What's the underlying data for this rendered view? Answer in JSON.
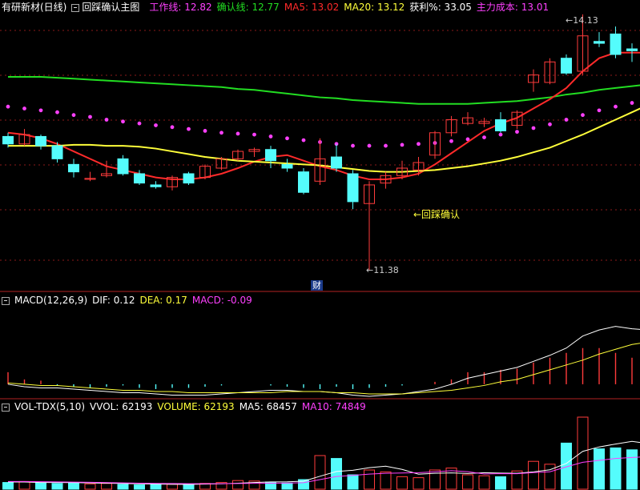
{
  "window": {
    "stock_name": "有研新材(日线)",
    "indicator_name": "回踩确认主图"
  },
  "main_header": {
    "work_line_label": "工作线: 12.82",
    "confirm_line_label": "确认线: 12.77",
    "ma5_label": "MA5: 13.02",
    "ma20_label": "MA20: 13.12",
    "profit_label": "获利%: 33.05",
    "main_cost_label": "主力成本: 13.01"
  },
  "annotations": {
    "high_label": "14.13",
    "low_label": "11.38",
    "confirm_label": "←回踩确认",
    "cai_badge": "财"
  },
  "macd_header": {
    "name": "MACD(12,26,9)",
    "dif_label": "DIF: 0.12",
    "dea_label": "DEA: 0.17",
    "macd_label": "MACD: -0.09"
  },
  "vol_header": {
    "name": "VOL-TDX(5,10)",
    "vvol_label": "VVOL: 62193",
    "volume_label": "VOLUME: 62193",
    "ma5_label": "MA5: 68457",
    "ma10_label": "MA10: 74849"
  },
  "colors": {
    "background": "#000000",
    "grid": "#8b1a1a",
    "pane_border": "#b22222",
    "rise": "#ff3b3b",
    "fall": "#54fcfc",
    "work_line": "#ff40ff",
    "confirm_line": "#22dd22",
    "ma5": "#ff2a2a",
    "ma20": "#ffff3a",
    "white_line": "#ffffff",
    "yellow_line": "#ffff3a",
    "magenta_line": "#ff40ff",
    "high_low_label": "#cccccc",
    "confirm_annotation": "#ffff3a",
    "badge_bg": "#1a3a8a"
  },
  "chart_data": [
    {
      "type": "candlestick",
      "title": "回踩确认主图",
      "y_range": [
        11.3,
        14.2
      ],
      "high_mark": 14.13,
      "low_mark": 11.38,
      "candles": [
        {
          "o": 12.82,
          "h": 12.86,
          "l": 12.7,
          "c": 12.74
        },
        {
          "o": 12.74,
          "h": 12.9,
          "l": 12.72,
          "c": 12.84
        },
        {
          "o": 12.82,
          "h": 12.84,
          "l": 12.68,
          "c": 12.72
        },
        {
          "o": 12.72,
          "h": 12.76,
          "l": 12.54,
          "c": 12.58
        },
        {
          "o": 12.52,
          "h": 12.58,
          "l": 12.38,
          "c": 12.44
        },
        {
          "o": 12.36,
          "h": 12.44,
          "l": 12.34,
          "c": 12.37
        },
        {
          "o": 12.4,
          "h": 12.56,
          "l": 12.38,
          "c": 12.42
        },
        {
          "o": 12.58,
          "h": 12.62,
          "l": 12.4,
          "c": 12.42
        },
        {
          "o": 12.42,
          "h": 12.46,
          "l": 12.3,
          "c": 12.32
        },
        {
          "o": 12.3,
          "h": 12.34,
          "l": 12.26,
          "c": 12.28
        },
        {
          "o": 12.28,
          "h": 12.4,
          "l": 12.24,
          "c": 12.38
        },
        {
          "o": 12.42,
          "h": 12.44,
          "l": 12.3,
          "c": 12.32
        },
        {
          "o": 12.38,
          "h": 12.52,
          "l": 12.36,
          "c": 12.5
        },
        {
          "o": 12.48,
          "h": 12.6,
          "l": 12.46,
          "c": 12.58
        },
        {
          "o": 12.58,
          "h": 12.68,
          "l": 12.56,
          "c": 12.66
        },
        {
          "o": 12.66,
          "h": 12.7,
          "l": 12.6,
          "c": 12.68
        },
        {
          "o": 12.68,
          "h": 12.72,
          "l": 12.48,
          "c": 12.56
        },
        {
          "o": 12.52,
          "h": 12.58,
          "l": 12.44,
          "c": 12.48
        },
        {
          "o": 12.44,
          "h": 12.48,
          "l": 12.2,
          "c": 12.22
        },
        {
          "o": 12.34,
          "h": 12.8,
          "l": 12.3,
          "c": 12.58
        },
        {
          "o": 12.6,
          "h": 12.74,
          "l": 12.44,
          "c": 12.48
        },
        {
          "o": 12.42,
          "h": 12.46,
          "l": 12.04,
          "c": 12.12
        },
        {
          "o": 12.1,
          "h": 12.34,
          "l": 11.38,
          "c": 12.3
        },
        {
          "o": 12.32,
          "h": 12.44,
          "l": 12.26,
          "c": 12.4
        },
        {
          "o": 12.4,
          "h": 12.56,
          "l": 12.36,
          "c": 12.48
        },
        {
          "o": 12.46,
          "h": 12.6,
          "l": 12.4,
          "c": 12.54
        },
        {
          "o": 12.62,
          "h": 12.88,
          "l": 12.58,
          "c": 12.86
        },
        {
          "o": 12.86,
          "h": 13.04,
          "l": 12.82,
          "c": 13.0
        },
        {
          "o": 12.96,
          "h": 13.08,
          "l": 12.94,
          "c": 13.02
        },
        {
          "o": 12.96,
          "h": 13.02,
          "l": 12.92,
          "c": 12.98
        },
        {
          "o": 13.0,
          "h": 13.08,
          "l": 12.86,
          "c": 12.88
        },
        {
          "o": 12.94,
          "h": 13.1,
          "l": 12.9,
          "c": 13.08
        },
        {
          "o": 13.4,
          "h": 13.54,
          "l": 13.3,
          "c": 13.48
        },
        {
          "o": 13.4,
          "h": 13.66,
          "l": 13.38,
          "c": 13.62
        },
        {
          "o": 13.66,
          "h": 13.7,
          "l": 13.48,
          "c": 13.5
        },
        {
          "o": 13.52,
          "h": 14.13,
          "l": 13.48,
          "c": 13.9
        },
        {
          "o": 13.84,
          "h": 13.94,
          "l": 13.78,
          "c": 13.82
        },
        {
          "o": 13.92,
          "h": 14.0,
          "l": 13.66,
          "c": 13.7
        },
        {
          "o": 13.76,
          "h": 13.82,
          "l": 13.62,
          "c": 13.74
        },
        {
          "o": 13.76,
          "h": 13.8,
          "l": 13.6,
          "c": 13.64
        }
      ],
      "series": [
        {
          "name": "确认线",
          "values": [
            13.46,
            13.46,
            13.46,
            13.45,
            13.44,
            13.43,
            13.42,
            13.41,
            13.4,
            13.39,
            13.38,
            13.37,
            13.36,
            13.35,
            13.33,
            13.32,
            13.3,
            13.28,
            13.26,
            13.24,
            13.23,
            13.21,
            13.2,
            13.19,
            13.18,
            13.17,
            13.17,
            13.17,
            13.17,
            13.18,
            13.19,
            13.2,
            13.22,
            13.24,
            13.27,
            13.29,
            13.32,
            13.34,
            13.36,
            13.38
          ]
        },
        {
          "name": "工作线",
          "values": [
            13.14,
            13.12,
            13.1,
            13.08,
            13.05,
            13.03,
            13.0,
            12.98,
            12.96,
            12.94,
            12.92,
            12.9,
            12.88,
            12.86,
            12.85,
            12.84,
            12.82,
            12.8,
            12.78,
            12.76,
            12.74,
            12.72,
            12.72,
            12.72,
            12.73,
            12.74,
            12.75,
            12.77,
            12.79,
            12.81,
            12.84,
            12.87,
            12.91,
            12.95,
            13.0,
            13.05,
            13.1,
            13.14,
            13.18,
            13.21
          ]
        },
        {
          "name": "MA5",
          "values": [
            12.86,
            12.84,
            12.8,
            12.74,
            12.66,
            12.58,
            12.5,
            12.46,
            12.42,
            12.38,
            12.36,
            12.36,
            12.38,
            12.42,
            12.48,
            12.55,
            12.6,
            12.62,
            12.56,
            12.5,
            12.46,
            12.4,
            12.36,
            12.36,
            12.38,
            12.42,
            12.52,
            12.64,
            12.76,
            12.88,
            12.96,
            13.02,
            13.12,
            13.22,
            13.34,
            13.52,
            13.66,
            13.72,
            13.72,
            13.72
          ]
        },
        {
          "name": "MA20",
          "values": [
            12.72,
            12.72,
            12.72,
            12.72,
            12.73,
            12.73,
            12.72,
            12.72,
            12.71,
            12.69,
            12.66,
            12.63,
            12.6,
            12.58,
            12.56,
            12.55,
            12.54,
            12.53,
            12.52,
            12.51,
            12.49,
            12.47,
            12.45,
            12.44,
            12.44,
            12.45,
            12.46,
            12.48,
            12.5,
            12.53,
            12.56,
            12.6,
            12.65,
            12.7,
            12.77,
            12.84,
            12.92,
            13.0,
            13.08,
            13.16
          ]
        }
      ]
    },
    {
      "type": "bar",
      "title": "MACD(12,26,9)",
      "y_range": [
        -0.1,
        0.65
      ],
      "macd_bars": [
        0.1,
        0.04,
        0.03,
        -0.01,
        -0.02,
        -0.03,
        -0.02,
        -0.01,
        -0.03,
        -0.04,
        -0.03,
        -0.03,
        -0.02,
        -0.01,
        0.0,
        0.0,
        -0.01,
        -0.02,
        -0.03,
        -0.04,
        -0.02,
        -0.04,
        -0.03,
        -0.02,
        -0.01,
        0.0,
        0.02,
        0.04,
        0.1,
        0.1,
        0.12,
        0.13,
        0.18,
        0.22,
        0.26,
        0.3,
        0.3,
        0.26,
        0.22,
        0.2
      ],
      "series": [
        {
          "name": "DIF",
          "values": [
            0.0,
            -0.02,
            -0.03,
            -0.03,
            -0.04,
            -0.05,
            -0.06,
            -0.07,
            -0.07,
            -0.08,
            -0.09,
            -0.09,
            -0.09,
            -0.08,
            -0.07,
            -0.06,
            -0.05,
            -0.05,
            -0.06,
            -0.06,
            -0.07,
            -0.09,
            -0.1,
            -0.09,
            -0.08,
            -0.06,
            -0.04,
            0.0,
            0.05,
            0.08,
            0.11,
            0.14,
            0.19,
            0.24,
            0.3,
            0.4,
            0.45,
            0.48,
            0.46,
            0.45
          ]
        },
        {
          "name": "DEA",
          "values": [
            0.01,
            0.0,
            -0.01,
            -0.01,
            -0.02,
            -0.03,
            -0.04,
            -0.05,
            -0.05,
            -0.06,
            -0.06,
            -0.07,
            -0.07,
            -0.07,
            -0.07,
            -0.07,
            -0.07,
            -0.06,
            -0.06,
            -0.06,
            -0.07,
            -0.07,
            -0.08,
            -0.08,
            -0.08,
            -0.07,
            -0.06,
            -0.05,
            -0.03,
            -0.01,
            0.02,
            0.04,
            0.08,
            0.12,
            0.16,
            0.2,
            0.25,
            0.29,
            0.33,
            0.35
          ]
        }
      ]
    },
    {
      "type": "bar",
      "title": "VOL-TDX(5,10)",
      "y_range": [
        0,
        160000
      ],
      "volume_bars": [
        14000,
        16000,
        13000,
        12000,
        14000,
        11000,
        12000,
        10000,
        9000,
        11000,
        10000,
        9000,
        12000,
        14000,
        18000,
        17000,
        15000,
        13000,
        20000,
        70000,
        64000,
        30000,
        40000,
        36000,
        26000,
        24000,
        40000,
        44000,
        30000,
        28000,
        26000,
        38000,
        58000,
        52000,
        96000,
        150000,
        84000,
        86000,
        82000,
        62193
      ],
      "series": [
        {
          "name": "MA5",
          "values": [
            15000,
            15000,
            14000,
            14000,
            13800,
            13200,
            12400,
            11800,
            11200,
            10600,
            10200,
            10000,
            10600,
            11200,
            12600,
            14000,
            15200,
            15400,
            16600,
            27000,
            36800,
            39400,
            44800,
            48000,
            41200,
            31200,
            33200,
            34000,
            32800,
            34400,
            33600,
            33200,
            36000,
            40400,
            53600,
            78800,
            88000,
            94000,
            99600,
            94800
          ]
        },
        {
          "name": "MA10",
          "values": [
            16000,
            16000,
            15600,
            15200,
            14800,
            14400,
            13800,
            13200,
            12600,
            12000,
            11800,
            11400,
            11400,
            11400,
            11800,
            12200,
            12600,
            12800,
            13600,
            20000,
            26400,
            28800,
            31400,
            33200,
            33800,
            34400,
            36200,
            38600,
            36400,
            31600,
            32400,
            32200,
            34600,
            36200,
            46400,
            56000,
            60000,
            64000,
            66000,
            68000
          ]
        }
      ]
    }
  ]
}
